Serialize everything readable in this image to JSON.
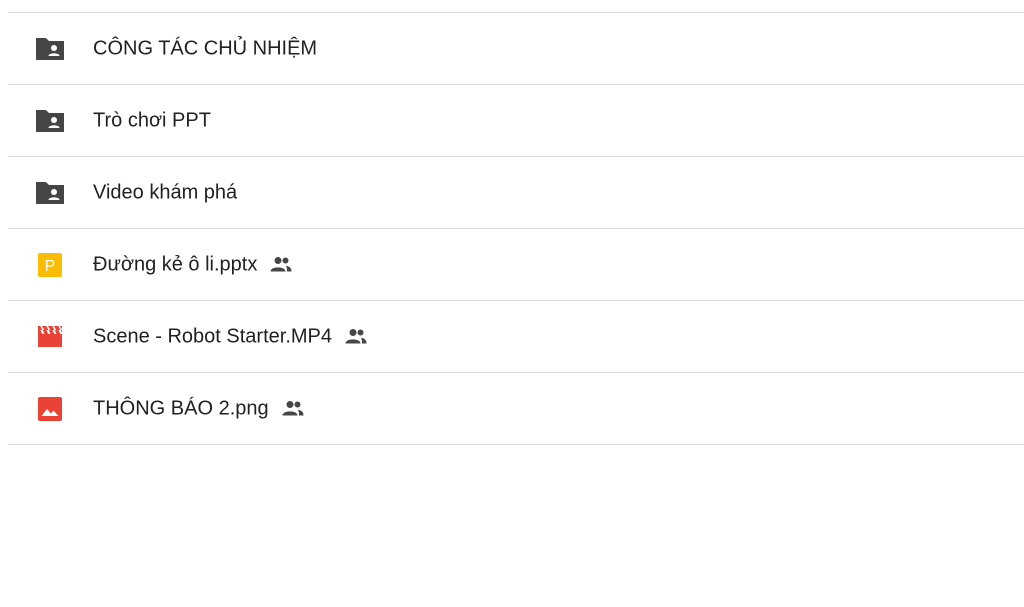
{
  "files": [
    {
      "name": "CÔNG TÁC CHỦ NHIỆM",
      "icon": "shared-folder-icon",
      "shared": false
    },
    {
      "name": "Trò chơi PPT",
      "icon": "shared-folder-icon",
      "shared": false
    },
    {
      "name": "Video khám phá",
      "icon": "shared-folder-icon",
      "shared": false
    },
    {
      "name": "Đường kẻ ô li.pptx",
      "icon": "slides-icon",
      "icon_letter": "P",
      "shared": true
    },
    {
      "name": "Scene - Robot Starter.MP4",
      "icon": "video-icon",
      "shared": true
    },
    {
      "name": "THÔNG BÁO 2.png",
      "icon": "image-icon",
      "shared": true
    }
  ],
  "colors": {
    "folder": "#444746",
    "slides": "#fbbc04",
    "video": "#ea4335",
    "image": "#ea4335",
    "text": "#202124",
    "divider": "#dadce0"
  }
}
